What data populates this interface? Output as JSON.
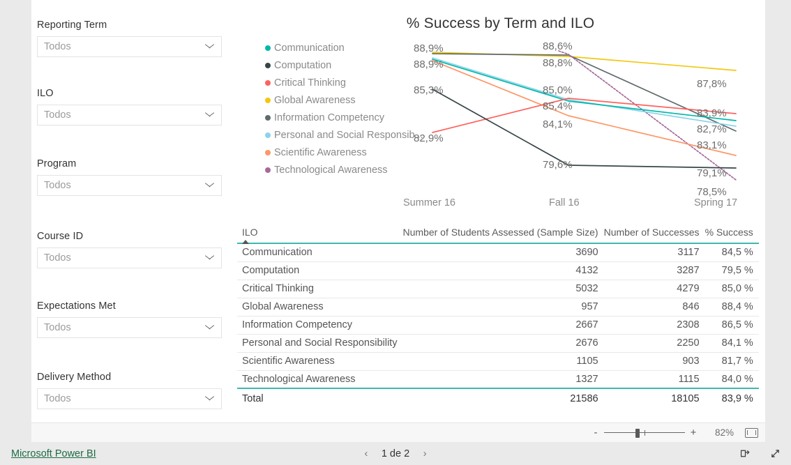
{
  "filters": {
    "items": [
      {
        "label": "Reporting Term",
        "value": "Todos",
        "icon": "chevron-down-icon"
      },
      {
        "label": "ILO",
        "value": "Todos",
        "icon": "chevron-down-icon"
      },
      {
        "label": "Program",
        "value": "Todos",
        "icon": "chevron-down-icon"
      },
      {
        "label": "Course ID",
        "value": "Todos",
        "icon": "chevron-down-icon"
      },
      {
        "label": "Expectations Met",
        "value": "Todos",
        "icon": "chevron-down-icon"
      },
      {
        "label": "Delivery Method",
        "value": "Todos",
        "icon": "chevron-down-icon"
      }
    ]
  },
  "chart_data": {
    "type": "line",
    "title": "% Success by Term and ILO",
    "xlabel": "",
    "ylabel": "",
    "grid": false,
    "legend_position": "left",
    "categories": [
      "Summer 16",
      "Fall 16",
      "Spring 17"
    ],
    "ylim": [
      78.0,
      89.5
    ],
    "series": [
      {
        "name": "Communication",
        "color": "#01B8AA",
        "values": [
          88.9,
          85.0,
          82.7
        ]
      },
      {
        "name": "Computation",
        "color": "#374649",
        "values": [
          85.3,
          79.6,
          79.1
        ]
      },
      {
        "name": "Critical Thinking",
        "color": "#FD625E",
        "values": [
          82.9,
          85.4,
          83.9
        ]
      },
      {
        "name": "Global Awareness",
        "color": "#F2C80F",
        "values": [
          88.9,
          88.8,
          87.8
        ]
      },
      {
        "name": "Information Competency",
        "color": "#5F6B6D",
        "values": [
          88.9,
          88.8,
          82.7
        ]
      },
      {
        "name": "Personal and Social Responsib...",
        "color": "#8AD4EB",
        "values": [
          88.9,
          85.0,
          83.1
        ]
      },
      {
        "name": "Scientific Awareness",
        "color": "#FE9666",
        "values": [
          88.9,
          84.1,
          79.1
        ]
      },
      {
        "name": "Technological Awareness",
        "color": "#A66999",
        "values": [
          88.6,
          88.6,
          78.5
        ]
      }
    ],
    "data_labels": {
      "Summer 16": [
        "88,9%",
        "88,9%",
        "85,3%",
        "82,9%"
      ],
      "Fall 16": [
        "88,6%",
        "88,8%",
        "85,0%",
        "85,4%",
        "84,1%",
        "79,6%"
      ],
      "Spring 17": [
        "87,8%",
        "83,9%",
        "82,7%",
        "83,1%",
        "79,1%",
        "78,5%"
      ]
    }
  },
  "table": {
    "columns": [
      "ILO",
      "Number of Students Assessed (Sample Size)",
      "Number of Successes",
      "% Success"
    ],
    "sort_icon": "sort-ascending-icon",
    "rows": [
      [
        "Communication",
        "3690",
        "3117",
        "84,5 %"
      ],
      [
        "Computation",
        "4132",
        "3287",
        "79,5 %"
      ],
      [
        "Critical Thinking",
        "5032",
        "4279",
        "85,0 %"
      ],
      [
        "Global Awareness",
        "957",
        "846",
        "88,4 %"
      ],
      [
        "Information Competency",
        "2667",
        "2308",
        "86,5 %"
      ],
      [
        "Personal and Social Responsibility",
        "2676",
        "2250",
        "84,1 %"
      ],
      [
        "Scientific Awareness",
        "1105",
        "903",
        "81,7 %"
      ],
      [
        "Technological Awareness",
        "1327",
        "1115",
        "84,0 %"
      ]
    ],
    "total": [
      "Total",
      "21586",
      "18105",
      "83,9 %"
    ],
    "accent_color": "#3fb8af"
  },
  "zoombar": {
    "minus_label": "-",
    "plus_label": "+",
    "zoom_level": "82%",
    "fit_icon": "fit-to-page-icon"
  },
  "statusbar": {
    "brand_link": "Microsoft Power BI",
    "prev_label": "‹",
    "page_indicator": "1 de 2",
    "next_label": "›",
    "share_icon": "share-icon",
    "fullscreen_icon": "fullscreen-icon",
    "link_color": "#1d6b45"
  }
}
